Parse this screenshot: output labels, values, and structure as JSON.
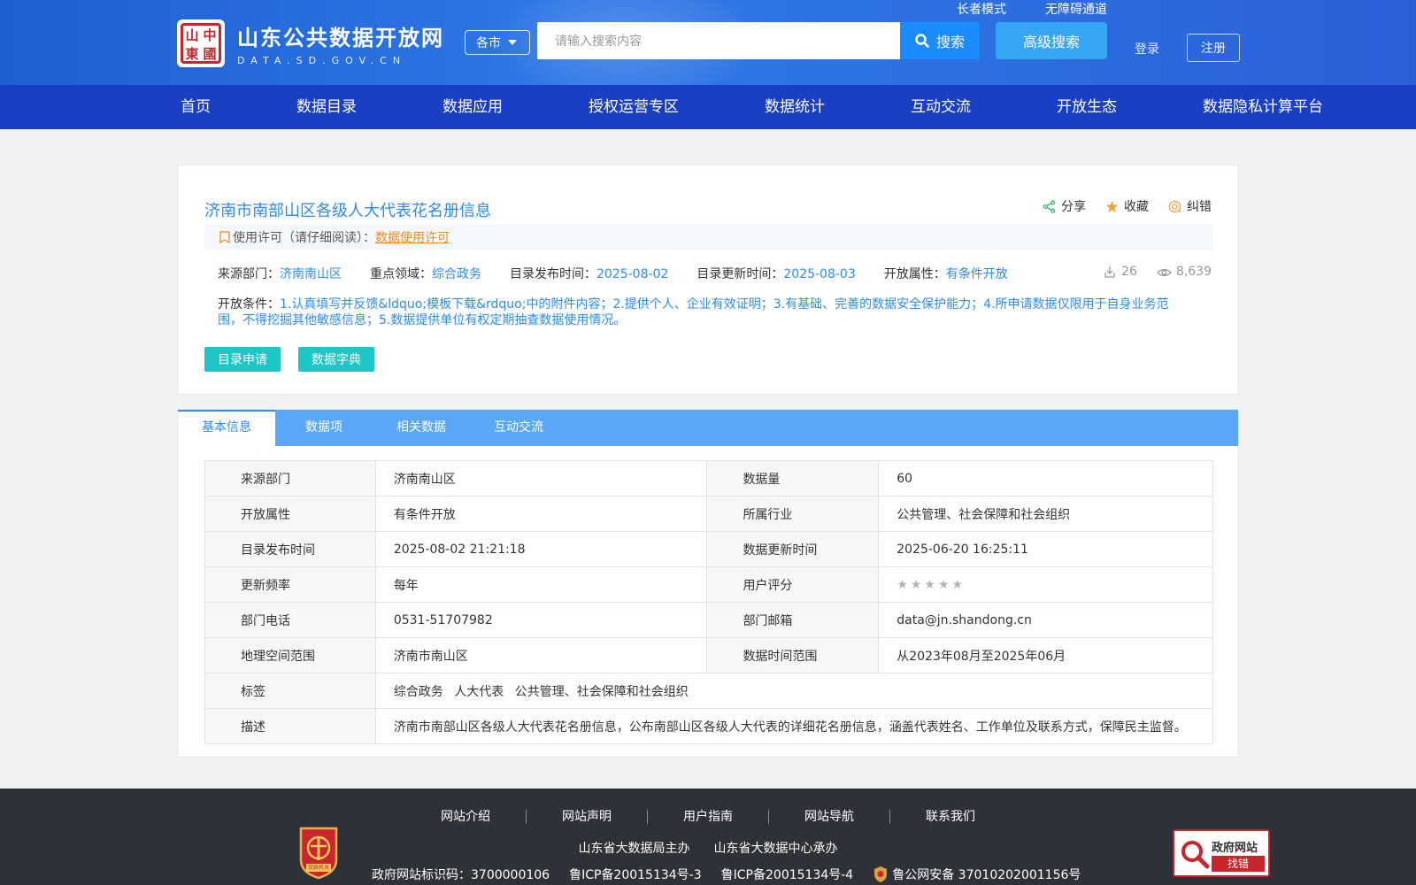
{
  "header": {
    "logo_title": "山东公共数据开放网",
    "logo_sub": "DATA.SD.GOV.CN",
    "logo_seal_chars": [
      "中",
      "國",
      "山",
      "東"
    ],
    "elder_mode": "长者模式",
    "accessibility": "无障碍通道",
    "city_select": "各市",
    "search_placeholder": "请输入搜索内容",
    "search_label": "搜索",
    "advanced_search": "高级搜索",
    "login": "登录",
    "register": "注册"
  },
  "nav": [
    "首页",
    "数据目录",
    "数据应用",
    "授权运营专区",
    "数据统计",
    "互动交流",
    "开放生态",
    "数据隐私计算平台"
  ],
  "dataset": {
    "title": "济南市南部山区各级人大代表花名册信息",
    "actions": {
      "share": "分享",
      "favorite": "收藏",
      "report": "纠错"
    },
    "license_prefix": "使用许可（请仔细阅读）：",
    "license_link": "数据使用许可",
    "source_label": "来源部门：",
    "source_value": "济南南山区",
    "field_label": "重点领域：",
    "field_value": "综合政务",
    "publish_label": "目录发布时间：",
    "publish_value": "2025-08-02",
    "update_label": "目录更新时间：",
    "update_value": "2025-08-03",
    "open_label": "开放属性：",
    "open_value": "有条件开放",
    "downloads": "26",
    "views": "8,639",
    "condition_label": "开放条件：",
    "condition_value": "1.认真填写并反馈&ldquo;模板下载&rdquo;中的附件内容；2.提供个人、企业有效证明；3.有基础、完善的数据安全保护能力；4.所申请数据仅限用于自身业务范围，不得挖掘其他敏感信息；5.数据提供单位有权定期抽查数据使用情况。",
    "btn_apply": "目录申请",
    "btn_dict": "数据字典"
  },
  "tabs": [
    "基本信息",
    "数据项",
    "相关数据",
    "互动交流"
  ],
  "info": {
    "r1": {
      "l1": "来源部门",
      "v1": "济南南山区",
      "l2": "数据量",
      "v2": "60"
    },
    "r2": {
      "l1": "开放属性",
      "v1": "有条件开放",
      "l2": "所属行业",
      "v2": "公共管理、社会保障和社会组织"
    },
    "r3": {
      "l1": "目录发布时间",
      "v1": "2025-08-02 21:21:18",
      "l2": "数据更新时间",
      "v2": "2025-06-20 16:25:11"
    },
    "r4": {
      "l1": "更新频率",
      "v1": "每年",
      "l2": "用户评分",
      "rating": 0
    },
    "r5": {
      "l1": "部门电话",
      "v1": "0531-51707982",
      "l2": "部门邮箱",
      "v2": "data@jn.shandong.cn"
    },
    "r6": {
      "l1": "地理空间范围",
      "v1": "济南市南山区",
      "l2": "数据时间范围",
      "v2": "从2023年08月至2025年06月"
    },
    "r7": {
      "l1": "标签",
      "tags": [
        "综合政务",
        "人大代表",
        "公共管理、社会保障和社会组织"
      ]
    },
    "r8": {
      "l1": "描述",
      "v1": "济南市南部山区各级人大代表花名册信息，公布南部山区各级人大代表的详细花名册信息，涵盖代表姓名、工作单位及联系方式，保障民主监督。"
    }
  },
  "footer": {
    "links": [
      "网站介绍",
      "网站声明",
      "用户指南",
      "网站导航",
      "联系我们"
    ],
    "host": "山东省大数据局主办",
    "organizer": "山东省大数据中心承办",
    "gov_id": "政府网站标识码：3700000106",
    "icp1": "鲁ICP备20015134号-3",
    "icp2": "鲁ICP备20015134号-4",
    "police": "鲁公网安备 37010202001156号",
    "party_badge": "党政机关",
    "gov_find_title": "政府网站",
    "gov_find_sub": "找错"
  }
}
